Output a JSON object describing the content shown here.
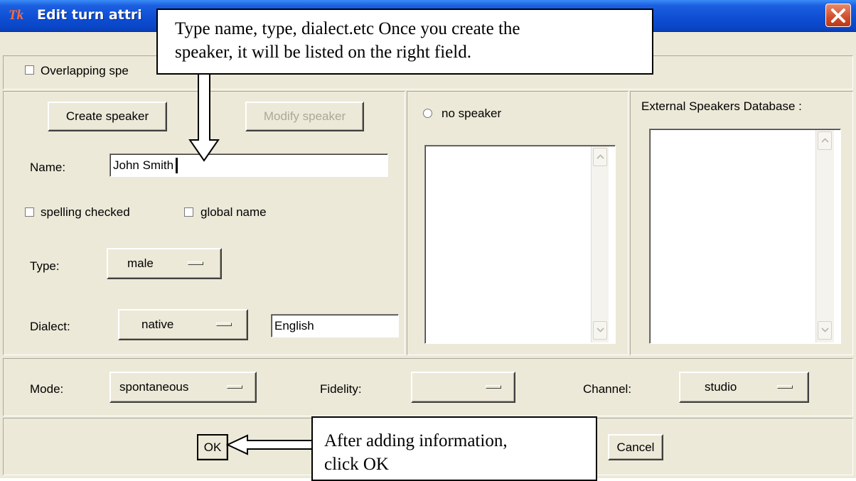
{
  "window": {
    "title": "Edit turn attri"
  },
  "overlap": {
    "label": "Overlapping spe"
  },
  "speaker": {
    "create_button": "Create speaker",
    "modify_button": "Modify speaker",
    "name_label": "Name:",
    "name_value": "John Smith",
    "spelling_checked": "spelling checked",
    "global_name": "global name",
    "type_label": "Type:",
    "type_value": "male",
    "dialect_label": "Dialect:",
    "dialect_value": "native",
    "dialect_text": "English"
  },
  "speakers_list": {
    "radio_label": "no speaker",
    "items": []
  },
  "external_db": {
    "label": "External Speakers Database :",
    "items": []
  },
  "attributes": {
    "mode_label": "Mode:",
    "mode_value": "spontaneous",
    "fidelity_label": "Fidelity:",
    "fidelity_value": "",
    "channel_label": "Channel:",
    "channel_value": "studio"
  },
  "buttons": {
    "ok": "OK",
    "cancel": "Cancel"
  },
  "callouts": {
    "top_line1": "Type name, type, dialect.etc  Once you create the",
    "top_line2": "speaker, it will be listed on the right field.",
    "bottom_line1": "After adding information,",
    "bottom_line2": "click OK"
  },
  "colors": {
    "titlebar": "#0f4fd4",
    "face": "#ece9d8",
    "close": "#d04e2a"
  }
}
